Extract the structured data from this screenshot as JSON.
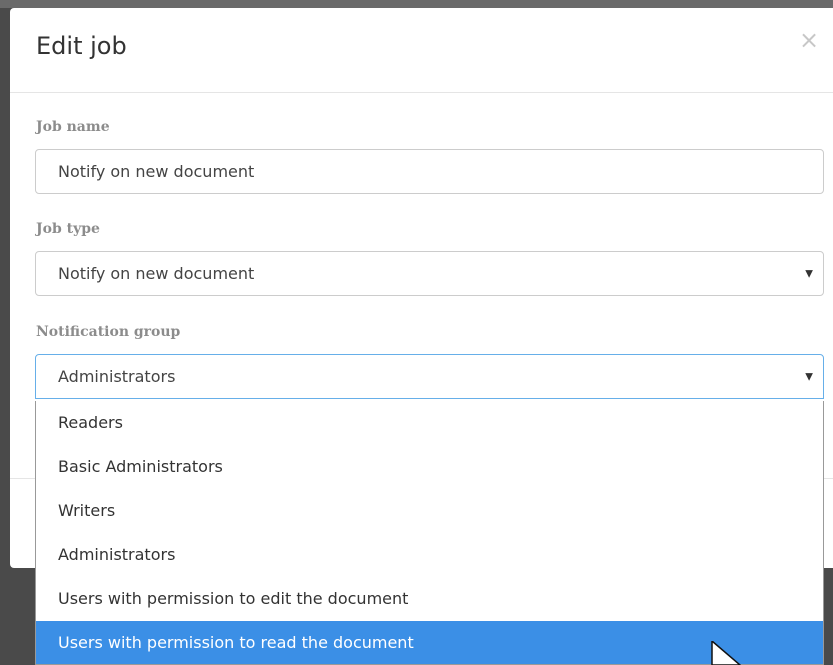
{
  "modal": {
    "title": "Edit job",
    "close_symbol": "×"
  },
  "fields": {
    "job_name": {
      "label": "Job name",
      "value": "Notify on new document"
    },
    "job_type": {
      "label": "Job type",
      "selected": "Notify on new document",
      "caret_symbol": "▼"
    },
    "notification_group": {
      "label": "Notification group",
      "selected": "Administrators",
      "caret_symbol": "▼",
      "options": [
        "Readers",
        "Basic Administrators",
        "Writers",
        "Administrators",
        "Users with permission to edit the document",
        "Users with permission to read the document"
      ],
      "highlighted_option": "Users with permission to read the document"
    }
  },
  "icons": {
    "close": "close-icon",
    "caret": "chevron-down-icon",
    "pointer": "mouse-pointer-icon"
  },
  "colors": {
    "highlight": "#3b8fe6",
    "label": "#8c8c8c",
    "focus_border": "#66afe9"
  }
}
